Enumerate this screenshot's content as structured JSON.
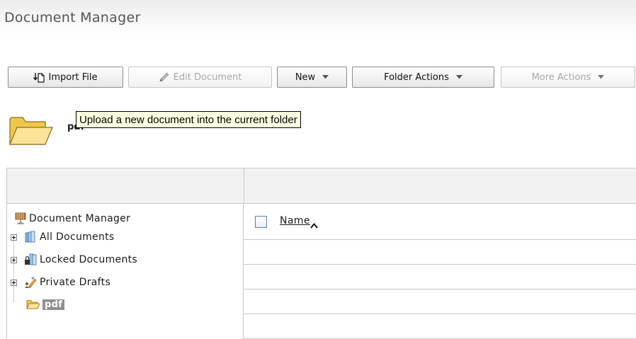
{
  "page": {
    "title": "Document Manager"
  },
  "toolbar": {
    "import_file": "Import File",
    "edit_document": "Edit Document",
    "new": "New",
    "folder_actions": "Folder Actions",
    "more_actions": "More Actions"
  },
  "current_folder": {
    "name": "pdf"
  },
  "tooltip": {
    "text": "Upload a new document into the current folder"
  },
  "tree": {
    "root": "Document Manager",
    "items": [
      {
        "label": "All Documents",
        "icon": "all-documents-icon"
      },
      {
        "label": "Locked Documents",
        "icon": "locked-documents-icon"
      },
      {
        "label": "Private Drafts",
        "icon": "private-drafts-icon"
      },
      {
        "label": "pdf",
        "icon": "folder-open-icon",
        "selected": true
      }
    ]
  },
  "file_list": {
    "columns": [
      {
        "label": "Name",
        "sort": "ascending"
      }
    ],
    "rows": []
  },
  "colors": {
    "tooltip_bg": "#ffffe1",
    "selection_bg": "#8f8f8f",
    "folder": "#f5d36a",
    "grid_border": "#c7c7c7"
  }
}
